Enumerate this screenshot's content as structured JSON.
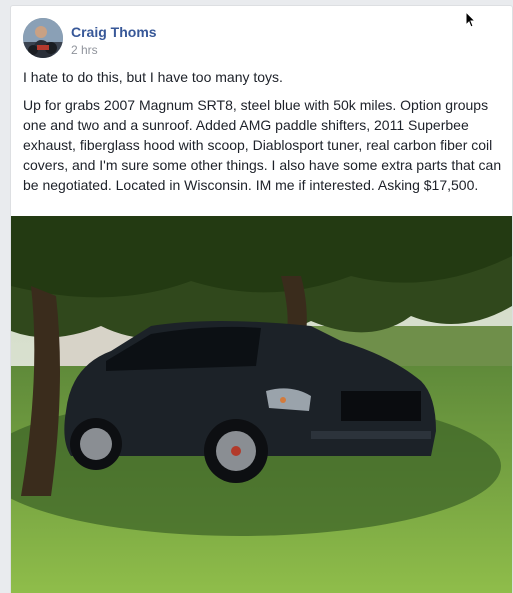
{
  "post": {
    "author": "Craig Thoms",
    "timestamp": "2 hrs",
    "paragraphs": [
      "I hate to do this, but I have too many toys.",
      "Up for grabs 2007 Magnum SRT8, steel blue with 50k miles. Option groups one and two and a sunroof. Added AMG paddle shifters, 2011 Superbee exhaust, fiberglass hood with scoop, Diablosport tuner, real carbon fiber coil covers, and I'm sure some other things. I also have some extra parts that can be negotiated. Located in Wisconsin. IM me if interested. Asking $17,500."
    ],
    "photo_subject": "dark blue station wagon parked on grass under a tree"
  },
  "icons": {
    "cursor": "mouse-pointer-icon",
    "avatar": "profile-avatar"
  },
  "colors": {
    "author_link": "#385898",
    "timestamp": "#90949c",
    "body_text": "#1d2129",
    "page_background": "#e9ebee"
  }
}
